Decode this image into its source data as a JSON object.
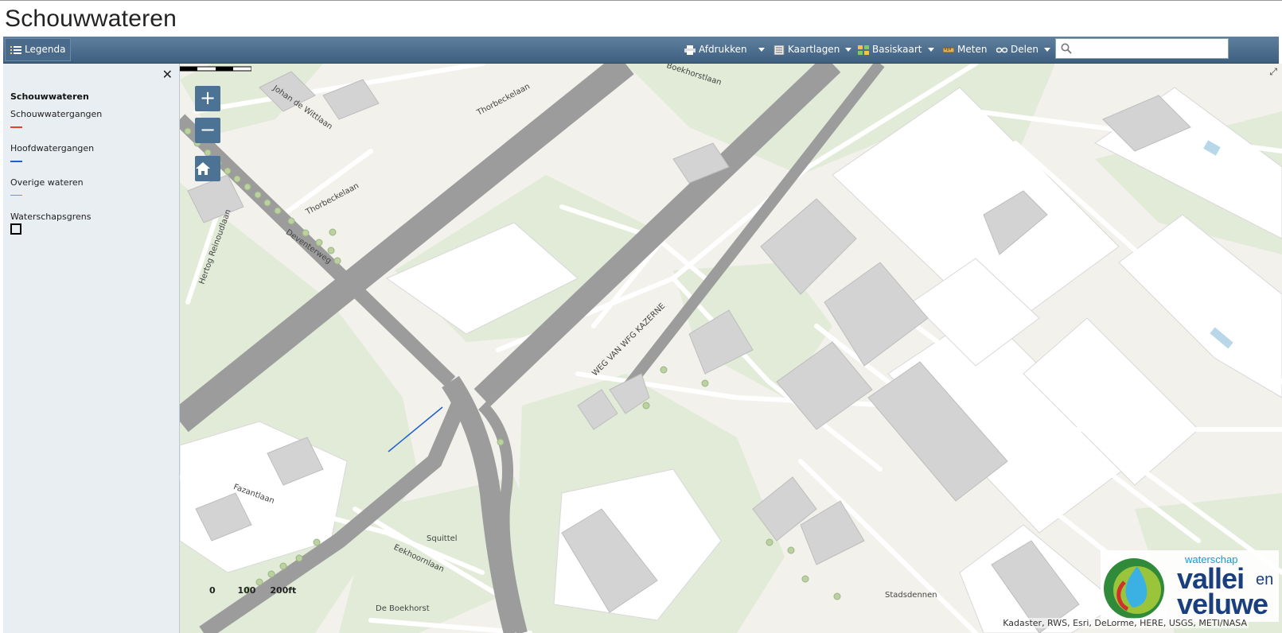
{
  "page_title": "Schouwwateren",
  "toolbar": {
    "legend_label": "Legenda",
    "print_label": "Afdrukken",
    "layers_label": "Kaartlagen",
    "basemap_label": "Basiskaart",
    "measure_label": "Meten",
    "share_label": "Delen",
    "search_placeholder": ""
  },
  "legend": {
    "title": "Schouwwateren",
    "items": [
      {
        "label": "Schouwwatergangen",
        "color": "#e8402a"
      },
      {
        "label": "Hoofdwatergangen",
        "color": "#1f5fcf"
      },
      {
        "label": "Overige wateren",
        "color": "#5a9be0"
      },
      {
        "label": "Waterschapsgrens",
        "color": "#000000"
      }
    ]
  },
  "map": {
    "street_labels": {
      "thorbeckelaan_1": "Thorbeckelaan",
      "thorbeckelaan_2": "Thorbeckelaan",
      "johan_de_wittlaan": "Johan de Wittlaan",
      "boekhorstlaan": "Boekhorstlaan",
      "hertog_reinoudlaan": "Hertog Reinoudlaan",
      "deventerweg": "Deventerweg",
      "weg_van_wfg_kazerne": "WEG VAN WFG KAZERNE",
      "fazantlaan": "Fazantlaan",
      "eekhoornlaan": "Eekhoornlaan",
      "squittel": "Squittel",
      "de_boekhorst": "De Boekhorst",
      "stadsdennen": "Stadsdennen"
    },
    "scale": {
      "zero": "0",
      "mid": "100",
      "end": "200ft"
    },
    "attribution": "Kadaster, RWS, Esri, DeLorme, HERE, USGS, METI/NASA",
    "zoom_in": "+",
    "zoom_out": "−"
  },
  "logo": {
    "small": "waterschap",
    "line1": "vallei",
    "line2": "veluwe",
    "en": "en"
  }
}
